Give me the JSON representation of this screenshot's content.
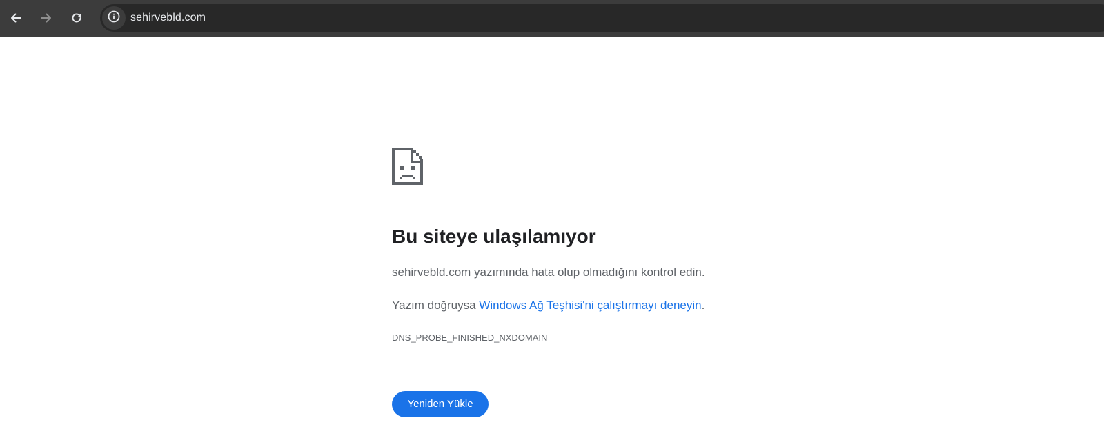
{
  "browser": {
    "url": "sehirvebld.com",
    "icons": {
      "back": "arrow-left-icon",
      "forward": "arrow-right-icon",
      "reload": "reload-icon",
      "site_info": "info-circle-icon"
    },
    "colors": {
      "toolbar_bg": "#3c3c3c",
      "omnibox_bg": "#282828",
      "url_text": "#e8eaed"
    }
  },
  "error_page": {
    "icon": "sad-document-icon",
    "title": "Bu siteye ulaşılamıyor",
    "check_message": "sehirvebld.com yazımında hata olup olmadığını kontrol edin.",
    "diagnostic_prefix": "Yazım doğruysa ",
    "diagnostic_link": "Windows Ağ Teşhisi'ni çalıştırmayı deneyin",
    "diagnostic_suffix": ".",
    "error_code": "DNS_PROBE_FINISHED_NXDOMAIN",
    "reload_button": "Yeniden Yükle",
    "colors": {
      "title": "#202124",
      "body_text": "#5f6368",
      "link": "#1a73e8",
      "button_bg": "#1a73e8",
      "button_text": "#ffffff"
    }
  }
}
